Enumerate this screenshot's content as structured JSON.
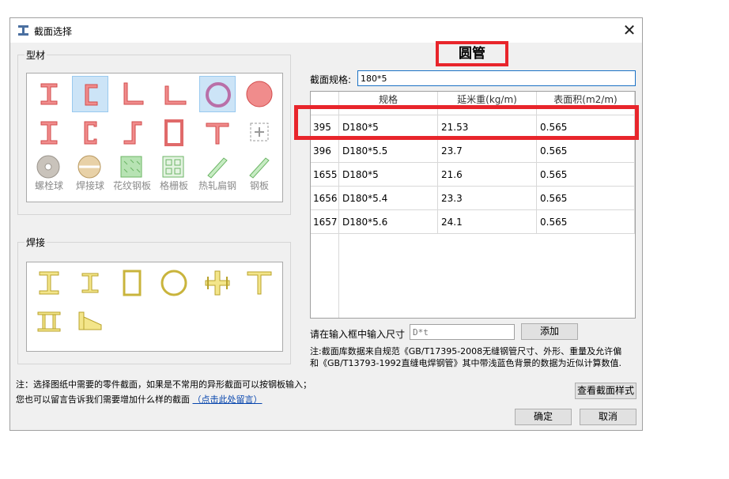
{
  "window": {
    "title": "截面选择",
    "close_glyph": "✕"
  },
  "heading": "圆管",
  "profiles": {
    "group_label": "型材",
    "items": [
      {
        "name": "i-beam-icon",
        "caption": ""
      },
      {
        "name": "channel-icon",
        "caption": ""
      },
      {
        "name": "angle-icon",
        "caption": ""
      },
      {
        "name": "unequal-angle-icon",
        "caption": ""
      },
      {
        "name": "round-tube-icon",
        "caption": ""
      },
      {
        "name": "round-bar-icon",
        "caption": ""
      },
      {
        "name": "h-section-icon",
        "caption": ""
      },
      {
        "name": "c-channel-icon",
        "caption": ""
      },
      {
        "name": "z-section-icon",
        "caption": ""
      },
      {
        "name": "rect-tube-icon",
        "caption": ""
      },
      {
        "name": "t-section-icon",
        "caption": ""
      },
      {
        "name": "add-custom-icon",
        "caption": ""
      },
      {
        "name": "bolt-ball-icon",
        "caption": "螺栓球"
      },
      {
        "name": "weld-ball-icon",
        "caption": "焊接球"
      },
      {
        "name": "checker-plate-icon",
        "caption": "花纹钢板"
      },
      {
        "name": "grating-icon",
        "caption": "格栅板"
      },
      {
        "name": "hot-rolled-flat-icon",
        "caption": "热轧扁钢"
      },
      {
        "name": "steel-plate-icon",
        "caption": "钢板"
      }
    ]
  },
  "welded": {
    "group_label": "焊接",
    "items": [
      {
        "name": "welded-i-icon"
      },
      {
        "name": "welded-h-icon"
      },
      {
        "name": "welded-box-icon"
      },
      {
        "name": "welded-ring-icon"
      },
      {
        "name": "welded-cross-icon"
      },
      {
        "name": "welded-t-icon"
      },
      {
        "name": "welded-double-icon"
      },
      {
        "name": "welded-tapered-icon"
      }
    ]
  },
  "spec": {
    "label": "截面规格:",
    "value": "180*5"
  },
  "table": {
    "headers": [
      "规格",
      "延米重(kg/m)",
      "表面积(m2/m)"
    ],
    "rows": [
      {
        "id": "395",
        "spec": "D180*5",
        "weight": "21.53",
        "area": "0.565"
      },
      {
        "id": "396",
        "spec": "D180*5.5",
        "weight": "23.7",
        "area": "0.565"
      },
      {
        "id": "1655",
        "spec": "D180*5",
        "weight": "21.6",
        "area": "0.565"
      },
      {
        "id": "1656",
        "spec": "D180*5.4",
        "weight": "23.3",
        "area": "0.565"
      },
      {
        "id": "1657",
        "spec": "D180*5.6",
        "weight": "24.1",
        "area": "0.565"
      }
    ]
  },
  "size_entry": {
    "label": "请在输入框中输入尺寸",
    "placeholder": "D*t",
    "add_label": "添加"
  },
  "source_note": {
    "line1": "注:截面库数据来自规范《GB/T17395-2008无缝钢管尺寸、外形、重量及允许偏",
    "line2": "和《GB/T13793-1992直缝电焊钢管》其中带浅蓝色背景的数据为近似计算数值."
  },
  "footer": {
    "note1": "注：选择图纸中需要的零件截面，如果是不常用的异形截面可以按钢板输入；",
    "note2": "您也可以留言告诉我们需要增加什么样的截面",
    "link": "（点击此处留言）",
    "view_style": "查看截面样式",
    "ok": "确定",
    "cancel": "取消"
  },
  "colors": {
    "profile": "#f08c8c",
    "profile_stroke": "#d24b4b",
    "weld": "#f3e58a",
    "weld_stroke": "#b8a22b",
    "highlight": "#e8252b",
    "selected": "#cce4f7"
  }
}
